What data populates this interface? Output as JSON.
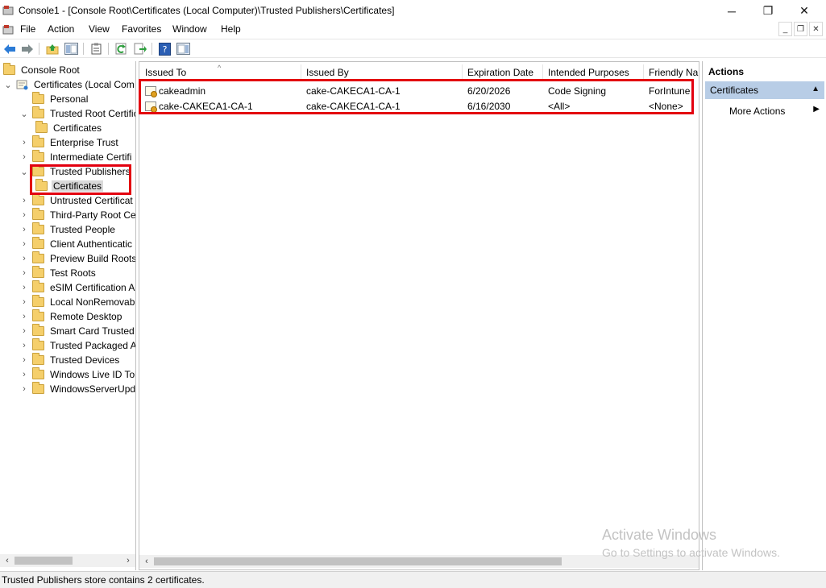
{
  "window": {
    "title": "Console1 - [Console Root\\Certificates (Local Computer)\\Trusted Publishers\\Certificates]",
    "minimize": "─",
    "restore": "❐",
    "close": "✕"
  },
  "menu": {
    "items": [
      "File",
      "Action",
      "View",
      "Favorites",
      "Window",
      "Help"
    ],
    "mdi_minimize": "_",
    "mdi_restore": "❐",
    "mdi_close": "✕"
  },
  "tree": {
    "root": "Console Root",
    "certificates_node": "Certificates (Local Com",
    "items": [
      {
        "label": "Personal",
        "expander": ""
      },
      {
        "label": "Trusted Root Certific",
        "expander": "⌄"
      },
      {
        "label": "Certificates",
        "expander": "",
        "child": true
      },
      {
        "label": "Enterprise Trust",
        "expander": "›"
      },
      {
        "label": "Intermediate Certifi",
        "expander": "›"
      },
      {
        "label": "Trusted Publishers",
        "expander": "⌄"
      },
      {
        "label": "Certificates",
        "expander": "",
        "child": true,
        "selected": true
      },
      {
        "label": "Untrusted Certificat",
        "expander": "›"
      },
      {
        "label": "Third-Party Root Ce",
        "expander": "›"
      },
      {
        "label": "Trusted People",
        "expander": "›"
      },
      {
        "label": "Client Authenticatic",
        "expander": "›"
      },
      {
        "label": "Preview Build Roots",
        "expander": "›"
      },
      {
        "label": "Test Roots",
        "expander": "›"
      },
      {
        "label": "eSIM Certification A",
        "expander": "›"
      },
      {
        "label": "Local NonRemovab",
        "expander": "›"
      },
      {
        "label": "Remote Desktop",
        "expander": "›"
      },
      {
        "label": "Smart Card Trusted",
        "expander": "›"
      },
      {
        "label": "Trusted Packaged A",
        "expander": "›"
      },
      {
        "label": "Trusted Devices",
        "expander": "›"
      },
      {
        "label": "Windows Live ID Tol",
        "expander": "›"
      },
      {
        "label": "WindowsServerUpd",
        "expander": "›"
      }
    ]
  },
  "list": {
    "columns": [
      "Issued To",
      "Issued By",
      "Expiration Date",
      "Intended Purposes",
      "Friendly Na"
    ],
    "rows": [
      {
        "issued_to": "cakeadmin",
        "issued_by": "cake-CAKECA1-CA-1",
        "expiration": "6/20/2026",
        "purposes": "Code Signing",
        "friendly": "ForIntune"
      },
      {
        "issued_to": "cake-CAKECA1-CA-1",
        "issued_by": "cake-CAKECA1-CA-1",
        "expiration": "6/16/2030",
        "purposes": "<All>",
        "friendly": "<None>"
      }
    ]
  },
  "actions": {
    "title": "Actions",
    "group": "Certificates",
    "more": "More Actions",
    "collapse_glyph": "▲",
    "more_glyph": "▶"
  },
  "watermark": {
    "line1": "Activate Windows",
    "line2": "Go to Settings to activate Windows."
  },
  "status": "Trusted Publishers store contains 2 certificates.",
  "colors": {
    "highlight": "#e3000f",
    "actions_group_bg": "#b8cde6",
    "selection": "#d9d9d9"
  }
}
